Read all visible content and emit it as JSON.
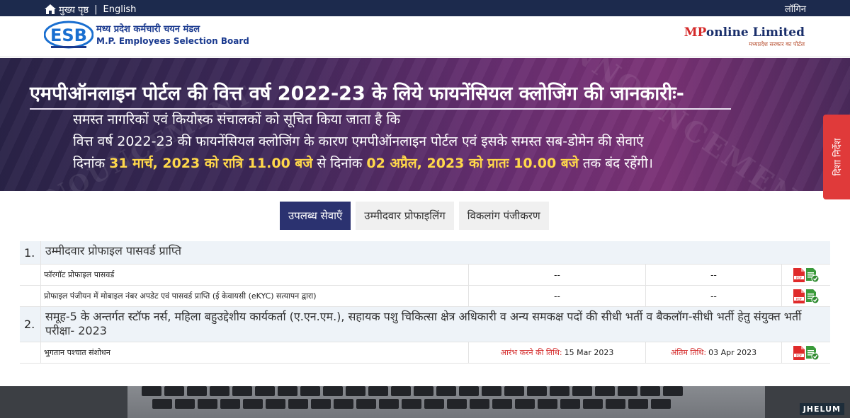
{
  "topbar": {
    "home_label": "मुख्य पृष्ठ",
    "lang_sep": "|",
    "lang_label": "English",
    "login_label": "लॉगिन"
  },
  "header": {
    "esb_mark": "ESB",
    "esb_name_hi": "मध्य प्रदेश कर्मचारी चयन मंडल",
    "esb_name_en": "M.P. Employees Selection Board",
    "mp_brand_red": "MP",
    "mp_brand_blue": "online Limited",
    "mp_tagline": "मध्यप्रदेश सरकार का पोर्टल"
  },
  "banner": {
    "title": "एमपीऑनलाइन पोर्टल की वित्त वर्ष 2022-23 के लिये फायनेंसियल क्लोजिंग की जानकारीः-",
    "line1": "समस्त नागरिकों एवं कियोस्क संचालकों को सूचित किया जाता है कि",
    "line2": "वित्त वर्ष 2022-23 की फायनेंसियल क्लोजिंग के कारण एमपीऑनलाइन पोर्टल एवं इसके समस्त सब-डोमेन की सेवाएं",
    "line3_a": "दिनांक ",
    "line3_b": "31 मार्च, 2023 को रात्रि 11.00 बजे",
    "line3_c": " से दिनांक ",
    "line3_d": "02 अप्रैल, 2023 को प्रातः 10.00 बजे",
    "line3_e": " तक बंद रहेंगी।",
    "stamp_text": "ANNOUNCEMENT"
  },
  "side_tab": {
    "label": "दिशा निर्देश"
  },
  "tabs": [
    {
      "label": "उपलब्ध सेवाएँ",
      "active": true
    },
    {
      "label": "उम्मीदवार प्रोफाइलिंग",
      "active": false
    },
    {
      "label": "विकलांग पंजीकरण",
      "active": false
    }
  ],
  "services": {
    "sections": [
      {
        "num": "1.",
        "title": "उम्मीदवार प्रोफाइल पासवर्ड प्राप्ति",
        "items": [
          {
            "name": "फॉरगॉट प्रोफाइल पासवर्ड",
            "start": "--",
            "end": "--"
          },
          {
            "name": "प्रोफाइल पंजीयन में मोबाइल नंबर अपडेट एवं पासवर्ड प्राप्ति (ई केवायसी (eKYC) सत्यापन द्वारा)",
            "start": "--",
            "end": "--"
          }
        ]
      },
      {
        "num": "2.",
        "title": "समूह-5 के अन्तर्गत स्टॉफ नर्स, महिला बहुउद्देशीय कार्यकर्ता (ए.एन.एम.), सहायक पशु चिकित्सा क्षेत्र अधिकारी व अन्य समकक्ष पदों की सीधी भर्ती व बैकलॉग-सीधी भर्ती हेतु संयुक्त भर्ती परीक्षा- 2023",
        "items": [
          {
            "name": "भुगतान पश्चात संशोधन",
            "start_label": "आरंभ करने की तिथि:",
            "start": "15 Mar 2023",
            "end_label": "अंतिम तिथि:",
            "end": "03 Apr 2023"
          }
        ]
      }
    ]
  },
  "footer": {
    "watermark": "JHELUM"
  },
  "colors": {
    "topbar": "#1c2a4d",
    "active_tab": "#2b3270",
    "side_tab": "#e03a3a",
    "highlight": "#ffd84a",
    "date_label": "#d42a2a"
  }
}
